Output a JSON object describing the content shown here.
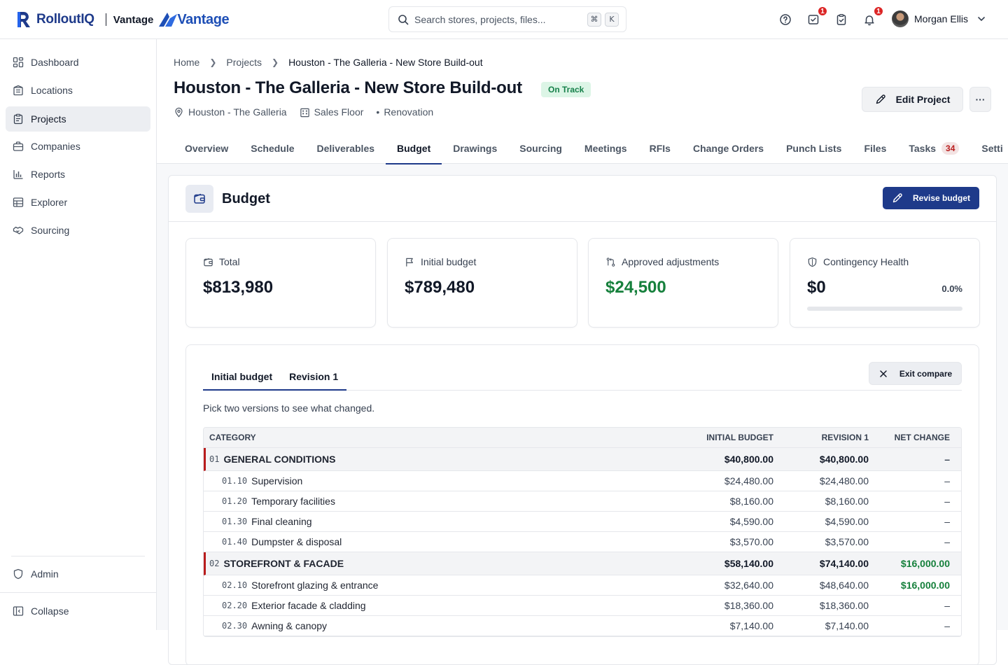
{
  "app": {
    "brand": "RolloutIQ",
    "workspace_label": "Vantage",
    "partner_brand": "Vantage"
  },
  "search": {
    "placeholder": "Search stores, projects, files...",
    "shortcut_keys": [
      "⌘",
      "K"
    ]
  },
  "topbar": {
    "icons": [
      {
        "name": "help-icon",
        "badge": ""
      },
      {
        "name": "inbox-check-icon",
        "badge": "1"
      },
      {
        "name": "clipboard-check-icon",
        "badge": ""
      },
      {
        "name": "bell-icon",
        "badge": "1"
      }
    ],
    "user_name": "Morgan Ellis"
  },
  "sidebar": {
    "items": [
      {
        "label": "Dashboard",
        "icon": "dashboard-icon",
        "active": false
      },
      {
        "label": "Locations",
        "icon": "building-icon",
        "active": false
      },
      {
        "label": "Projects",
        "icon": "clipboard-icon",
        "active": true
      },
      {
        "label": "Companies",
        "icon": "briefcase-icon",
        "active": false
      },
      {
        "label": "Reports",
        "icon": "bar-chart-icon",
        "active": false
      },
      {
        "label": "Explorer",
        "icon": "table-icon",
        "active": false
      },
      {
        "label": "Sourcing",
        "icon": "handshake-icon",
        "active": false
      }
    ],
    "admin_label": "Admin",
    "collapse_label": "Collapse"
  },
  "breadcrumb": [
    "Home",
    "Projects",
    "Houston - The Galleria - New Store Build-out"
  ],
  "project": {
    "title": "Houston - The Galleria - New Store Build-out",
    "status": "On Track",
    "location": "Houston - The Galleria",
    "area": "Sales Floor",
    "type": "Renovation",
    "edit_label": "Edit Project",
    "more_label": "···"
  },
  "tabs": [
    {
      "label": "Overview"
    },
    {
      "label": "Schedule"
    },
    {
      "label": "Deliverables"
    },
    {
      "label": "Budget",
      "active": true
    },
    {
      "label": "Drawings"
    },
    {
      "label": "Sourcing"
    },
    {
      "label": "Meetings"
    },
    {
      "label": "RFIs"
    },
    {
      "label": "Change Orders"
    },
    {
      "label": "Punch Lists"
    },
    {
      "label": "Files"
    },
    {
      "label": "Tasks",
      "count": "34"
    },
    {
      "label": "Setti"
    }
  ],
  "budget": {
    "title": "Budget",
    "revise_label": "Revise budget",
    "stats": {
      "total": {
        "label": "Total",
        "value": "$813,980"
      },
      "initial": {
        "label": "Initial budget",
        "value": "$789,480"
      },
      "adjustments": {
        "label": "Approved adjustments",
        "value": "$24,500"
      },
      "contingency": {
        "label": "Contingency Health",
        "value": "$0",
        "percent": "0.0%",
        "fill": 0.0
      }
    },
    "compare": {
      "tabs": [
        "Initial budget",
        "Revision 1"
      ],
      "exit_label": "Exit compare",
      "hint": "Pick two versions to see what changed.",
      "columns": [
        "CATEGORY",
        "INITIAL BUDGET",
        "REVISION 1",
        "NET CHANGE"
      ],
      "rows": [
        {
          "kind": "group",
          "code": "01",
          "name": "GENERAL CONDITIONS",
          "initial": "$40,800.00",
          "revision": "$40,800.00",
          "net": "–"
        },
        {
          "kind": "item",
          "code": "01.10",
          "name": "Supervision",
          "initial": "$24,480.00",
          "revision": "$24,480.00",
          "net": "–"
        },
        {
          "kind": "item",
          "code": "01.20",
          "name": "Temporary facilities",
          "initial": "$8,160.00",
          "revision": "$8,160.00",
          "net": "–"
        },
        {
          "kind": "item",
          "code": "01.30",
          "name": "Final cleaning",
          "initial": "$4,590.00",
          "revision": "$4,590.00",
          "net": "–"
        },
        {
          "kind": "item",
          "code": "01.40",
          "name": "Dumpster & disposal",
          "initial": "$3,570.00",
          "revision": "$3,570.00",
          "net": "–"
        },
        {
          "kind": "group",
          "code": "02",
          "name": "STOREFRONT & FACADE",
          "initial": "$58,140.00",
          "revision": "$74,140.00",
          "net": "$16,000.00"
        },
        {
          "kind": "item",
          "code": "02.10",
          "name": "Storefront glazing & entrance",
          "initial": "$32,640.00",
          "revision": "$48,640.00",
          "net": "$16,000.00"
        },
        {
          "kind": "item",
          "code": "02.20",
          "name": "Exterior facade & cladding",
          "initial": "$18,360.00",
          "revision": "$18,360.00",
          "net": "–"
        },
        {
          "kind": "item",
          "code": "02.30",
          "name": "Awning & canopy",
          "initial": "$7,140.00",
          "revision": "$7,140.00",
          "net": "–"
        }
      ]
    }
  },
  "colors": {
    "brand_navy": "#1e3a8a",
    "success_green": "#16803c",
    "badge_red": "#dc2626",
    "status_bg": "#dcf5e6"
  }
}
